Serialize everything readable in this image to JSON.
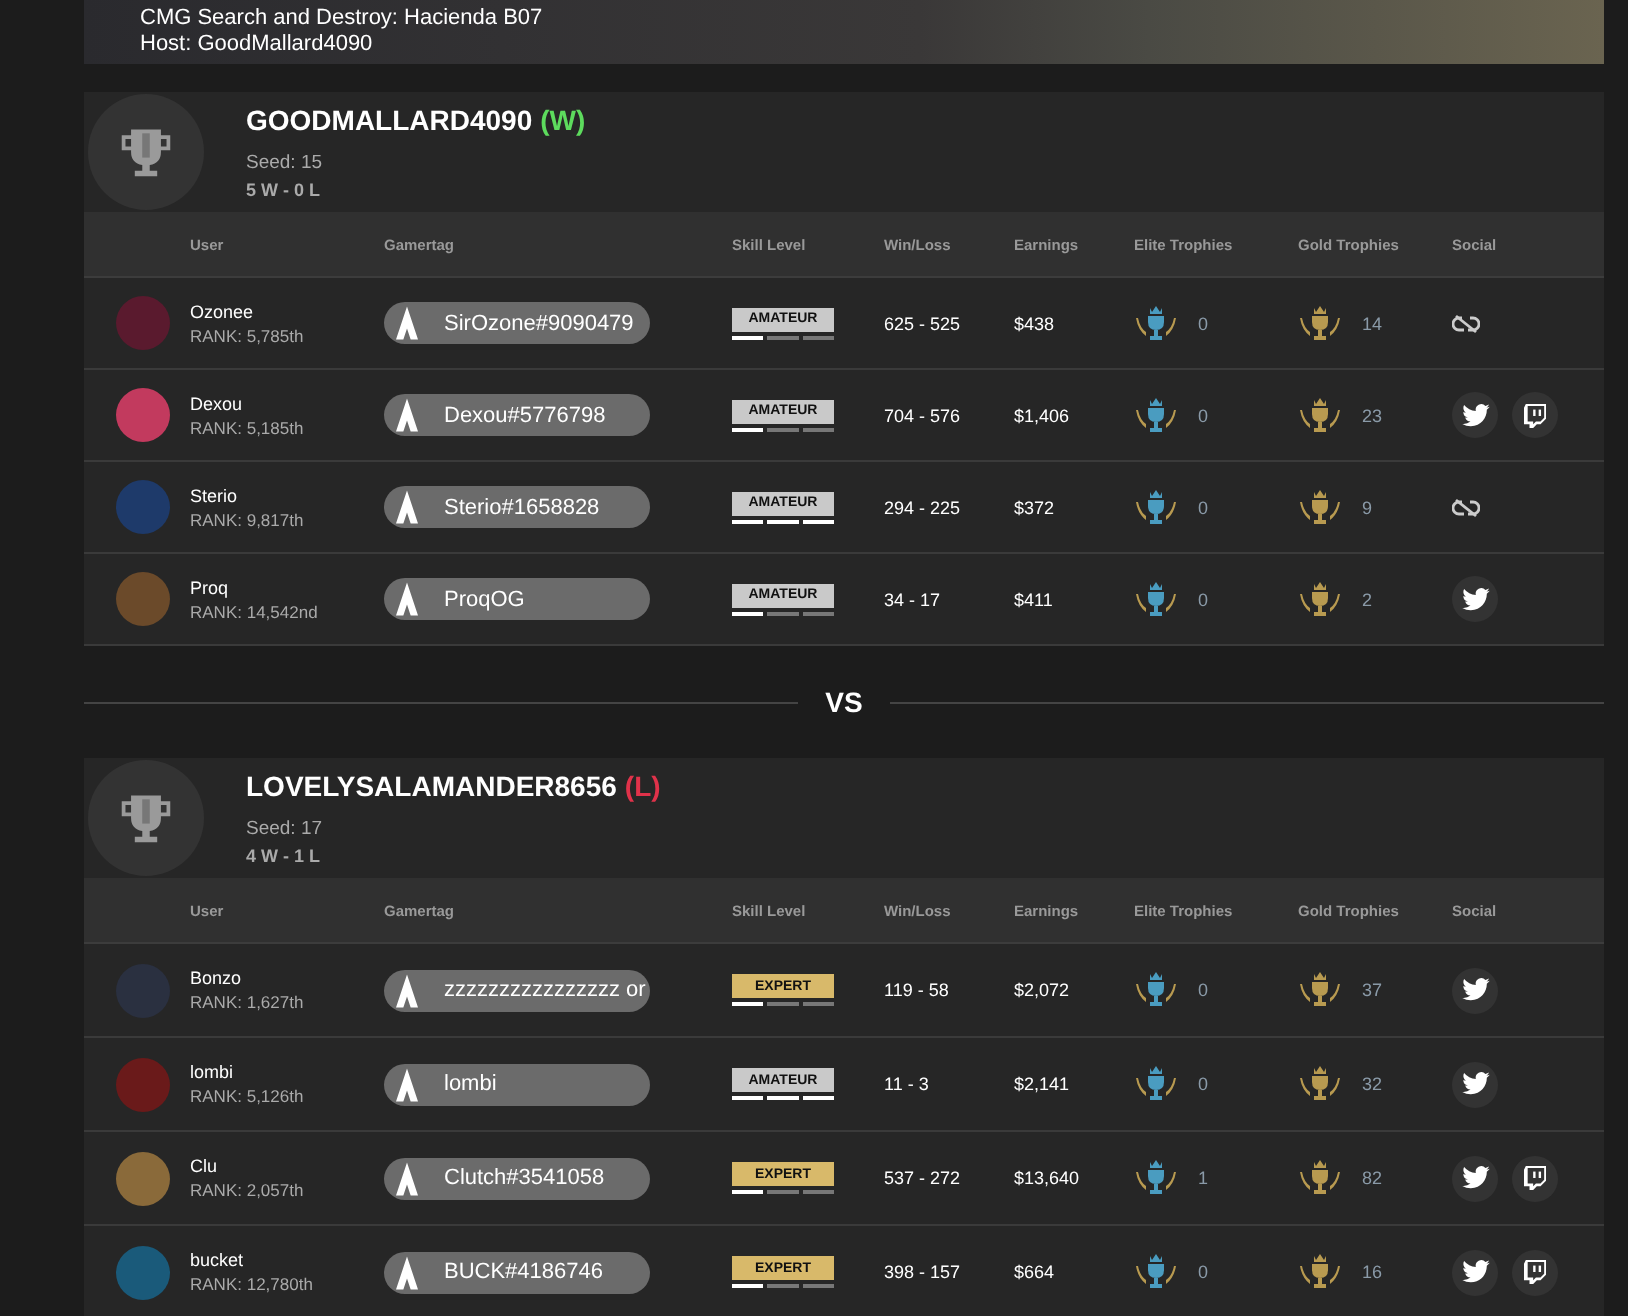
{
  "banner": {
    "lines": [
      "CMG Search and Destroy: Hacienda B07",
      "Host: GoodMallard4090"
    ]
  },
  "teams": [
    {
      "name": "GOODMALLARD4090",
      "result": {
        "kind": "win",
        "label": "(W)"
      },
      "seed": "Seed: 15",
      "record": "5 W - 0 L",
      "columns": [
        "User",
        "Gamertag",
        "Skill Level",
        "Win/Loss",
        "Earnings",
        "Elite Trophies",
        "Gold Trophies",
        "Social"
      ],
      "players": [
        {
          "user": "Ozonee",
          "rank": "RANK: 5,785th",
          "gamertag": "SirOzone#9090479",
          "skill": {
            "kind": "amateur",
            "label": "AMATEUR",
            "level": 0.33
          },
          "win_loss": "625 - 525",
          "earnings": "$438",
          "elite": "0",
          "gold": "14",
          "social": [
            {
              "kind": "unlinked"
            }
          ]
        },
        {
          "user": "Dexou",
          "rank": "RANK: 5,185th",
          "gamertag": "Dexou#5776798",
          "skill": {
            "kind": "amateur",
            "label": "AMATEUR",
            "level": 0.33
          },
          "win_loss": "704 - 576",
          "earnings": "$1,406",
          "elite": "0",
          "gold": "23",
          "social": [
            {
              "kind": "twitter"
            },
            {
              "kind": "twitch"
            }
          ]
        },
        {
          "user": "Sterio",
          "rank": "RANK: 9,817th",
          "gamertag": "Sterio#1658828",
          "skill": {
            "kind": "amateur",
            "label": "AMATEUR",
            "level": 1
          },
          "win_loss": "294 - 225",
          "earnings": "$372",
          "elite": "0",
          "gold": "9",
          "social": [
            {
              "kind": "unlinked"
            }
          ]
        },
        {
          "user": "Proq",
          "rank": "RANK: 14,542nd",
          "gamertag": "ProqOG",
          "skill": {
            "kind": "amateur",
            "label": "AMATEUR",
            "level": 0.33
          },
          "win_loss": "34 - 17",
          "earnings": "$411",
          "elite": "0",
          "gold": "2",
          "social": [
            {
              "kind": "twitter"
            }
          ]
        }
      ]
    },
    {
      "name": "LOVELYSALAMANDER8656",
      "result": {
        "kind": "loss",
        "label": "(L)"
      },
      "seed": "Seed: 17",
      "record": "4 W - 1 L",
      "columns": [
        "User",
        "Gamertag",
        "Skill Level",
        "Win/Loss",
        "Earnings",
        "Elite Trophies",
        "Gold Trophies",
        "Social"
      ],
      "players": [
        {
          "user": "Bonzo",
          "rank": "RANK: 1,627th",
          "gamertag": "zzzzzzzzzzzzzzzz or",
          "skill": {
            "kind": "expert",
            "label": "EXPERT",
            "level": 0.33
          },
          "win_loss": "119 - 58",
          "earnings": "$2,072",
          "elite": "0",
          "gold": "37",
          "social": [
            {
              "kind": "twitter"
            }
          ]
        },
        {
          "user": "lombi",
          "rank": "RANK: 5,126th",
          "gamertag": "lombi",
          "skill": {
            "kind": "amateur",
            "label": "AMATEUR",
            "level": 1
          },
          "win_loss": "11 - 3",
          "earnings": "$2,141",
          "elite": "0",
          "gold": "32",
          "social": [
            {
              "kind": "twitter"
            }
          ]
        },
        {
          "user": "Clu",
          "rank": "RANK: 2,057th",
          "gamertag": "Clutch#3541058",
          "skill": {
            "kind": "expert",
            "label": "EXPERT",
            "level": 0.33
          },
          "win_loss": "537 - 272",
          "earnings": "$13,640",
          "elite": "1",
          "gold": "82",
          "social": [
            {
              "kind": "twitter"
            },
            {
              "kind": "twitch"
            }
          ]
        },
        {
          "user": "bucket",
          "rank": "RANK: 12,780th",
          "gamertag": "BUCK#4186746",
          "skill": {
            "kind": "expert",
            "label": "EXPERT",
            "level": 0.33
          },
          "win_loss": "398 - 157",
          "earnings": "$664",
          "elite": "0",
          "gold": "16",
          "social": [
            {
              "kind": "twitter"
            },
            {
              "kind": "twitch"
            }
          ]
        }
      ]
    }
  ],
  "versus": "VS"
}
